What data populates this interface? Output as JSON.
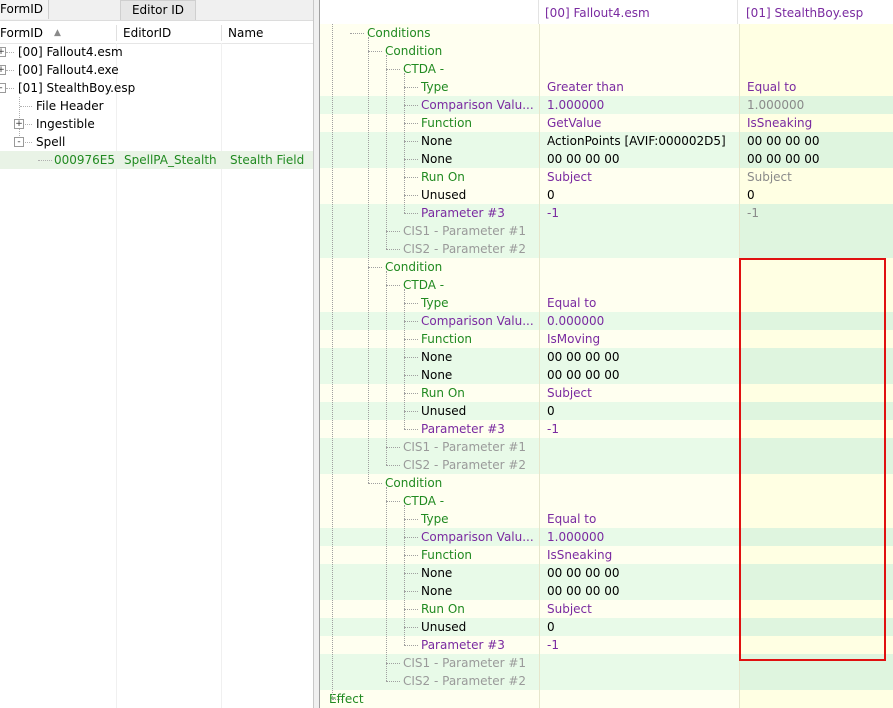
{
  "left_pane": {
    "tabs": [
      "FormID",
      "Editor ID"
    ],
    "columns": [
      "FormID",
      "EditorID",
      "Name"
    ],
    "tree": [
      {
        "label": "[00] Fallout4.esm",
        "expander": "+"
      },
      {
        "label": "[00] Fallout4.exe",
        "expander": "+"
      },
      {
        "label": "[01] StealthBoy.esp",
        "expander": "-"
      },
      {
        "label": "File Header"
      },
      {
        "label": "Ingestible",
        "expander": "+"
      },
      {
        "label": "Spell",
        "expander": "-"
      }
    ],
    "selected_record": {
      "formid": "000976E5",
      "editorid": "SpellPA_Stealth",
      "name": "Stealth Field"
    }
  },
  "right_pane": {
    "columns": [
      "",
      "[00] Fallout4.esm",
      "[01] StealthBoy.esp"
    ],
    "rows": [
      {
        "label": "Conditions",
        "v1": "",
        "v2": ""
      },
      {
        "label": "Condition",
        "v1": "",
        "v2": ""
      },
      {
        "label": "CTDA -",
        "v1": "",
        "v2": ""
      },
      {
        "label": "Type",
        "v1": "Greater than",
        "v2": "Equal to"
      },
      {
        "label": "Comparison Valu...",
        "v1": "1.000000",
        "v2": "1.000000"
      },
      {
        "label": "Function",
        "v1": "GetValue",
        "v2": "IsSneaking"
      },
      {
        "label": "None",
        "v1": "ActionPoints [AVIF:000002D5]",
        "v2": "00 00 00 00"
      },
      {
        "label": "None",
        "v1": "00 00 00 00",
        "v2": "00 00 00 00"
      },
      {
        "label": "Run On",
        "v1": "Subject",
        "v2": "Subject"
      },
      {
        "label": "Unused",
        "v1": "0",
        "v2": "0"
      },
      {
        "label": "Parameter #3",
        "v1": "-1",
        "v2": "-1"
      },
      {
        "label": "CIS1 - Parameter #1",
        "v1": "",
        "v2": ""
      },
      {
        "label": "CIS2 - Parameter #2",
        "v1": "",
        "v2": ""
      },
      {
        "label": "Condition",
        "v1": "",
        "v2": ""
      },
      {
        "label": "CTDA -",
        "v1": "",
        "v2": ""
      },
      {
        "label": "Type",
        "v1": "Equal to",
        "v2": ""
      },
      {
        "label": "Comparison Valu...",
        "v1": "0.000000",
        "v2": ""
      },
      {
        "label": "Function",
        "v1": "IsMoving",
        "v2": ""
      },
      {
        "label": "None",
        "v1": "00 00 00 00",
        "v2": ""
      },
      {
        "label": "None",
        "v1": "00 00 00 00",
        "v2": ""
      },
      {
        "label": "Run On",
        "v1": "Subject",
        "v2": ""
      },
      {
        "label": "Unused",
        "v1": "0",
        "v2": ""
      },
      {
        "label": "Parameter #3",
        "v1": "-1",
        "v2": ""
      },
      {
        "label": "CIS1 - Parameter #1",
        "v1": "",
        "v2": ""
      },
      {
        "label": "CIS2 - Parameter #2",
        "v1": "",
        "v2": ""
      },
      {
        "label": "Condition",
        "v1": "",
        "v2": ""
      },
      {
        "label": "CTDA -",
        "v1": "",
        "v2": ""
      },
      {
        "label": "Type",
        "v1": "Equal to",
        "v2": ""
      },
      {
        "label": "Comparison Valu...",
        "v1": "1.000000",
        "v2": ""
      },
      {
        "label": "Function",
        "v1": "IsSneaking",
        "v2": ""
      },
      {
        "label": "None",
        "v1": "00 00 00 00",
        "v2": ""
      },
      {
        "label": "None",
        "v1": "00 00 00 00",
        "v2": ""
      },
      {
        "label": "Run On",
        "v1": "Subject",
        "v2": ""
      },
      {
        "label": "Unused",
        "v1": "0",
        "v2": ""
      },
      {
        "label": "Parameter #3",
        "v1": "-1",
        "v2": ""
      },
      {
        "label": "CIS1 - Parameter #1",
        "v1": "",
        "v2": ""
      },
      {
        "label": "CIS2 - Parameter #2",
        "v1": "",
        "v2": ""
      },
      {
        "label": "Effect",
        "v1": "",
        "v2": ""
      }
    ]
  },
  "colors": {
    "green_text": "#218a21",
    "purple_text": "#7a2aa0",
    "row_yellow": "#fffff0",
    "row_green": "#e8fae8",
    "highlight_box": "#e01010"
  }
}
